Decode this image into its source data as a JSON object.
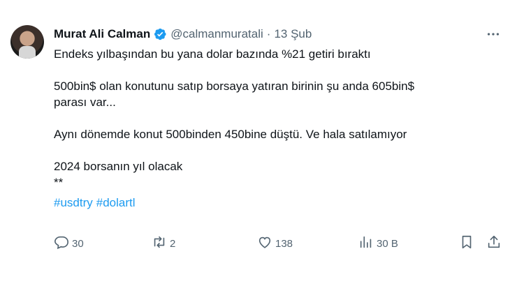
{
  "author": {
    "name": "Murat Ali Calman",
    "handle": "@calmanmuratali",
    "separator": "·",
    "date": "13 Şub"
  },
  "tweet": {
    "lines": [
      "Endeks yılbaşından bu yana dolar bazında %21 getiri bıraktı",
      "",
      "500bin$ olan konutunu satıp borsaya yatıran birinin şu anda 605bin$",
      "parası var...",
      "",
      "Aynı dönemde konut 500binden 450bine düştü. Ve hala satılamıyor",
      "",
      "2024 borsanın yıl olacak",
      "**"
    ],
    "hashtags": [
      "#usdtry",
      "#dolartl"
    ]
  },
  "actions": {
    "replies": "30",
    "retweets": "2",
    "likes": "138",
    "views": "30 B"
  },
  "colors": {
    "text": "#0f1419",
    "secondary": "#536471",
    "link": "#1d9bf0",
    "verified": "#1d9bf0"
  },
  "icons": [
    "verified-badge-icon",
    "more-icon",
    "reply-icon",
    "retweet-icon",
    "like-icon",
    "views-icon",
    "bookmark-icon",
    "share-icon"
  ]
}
